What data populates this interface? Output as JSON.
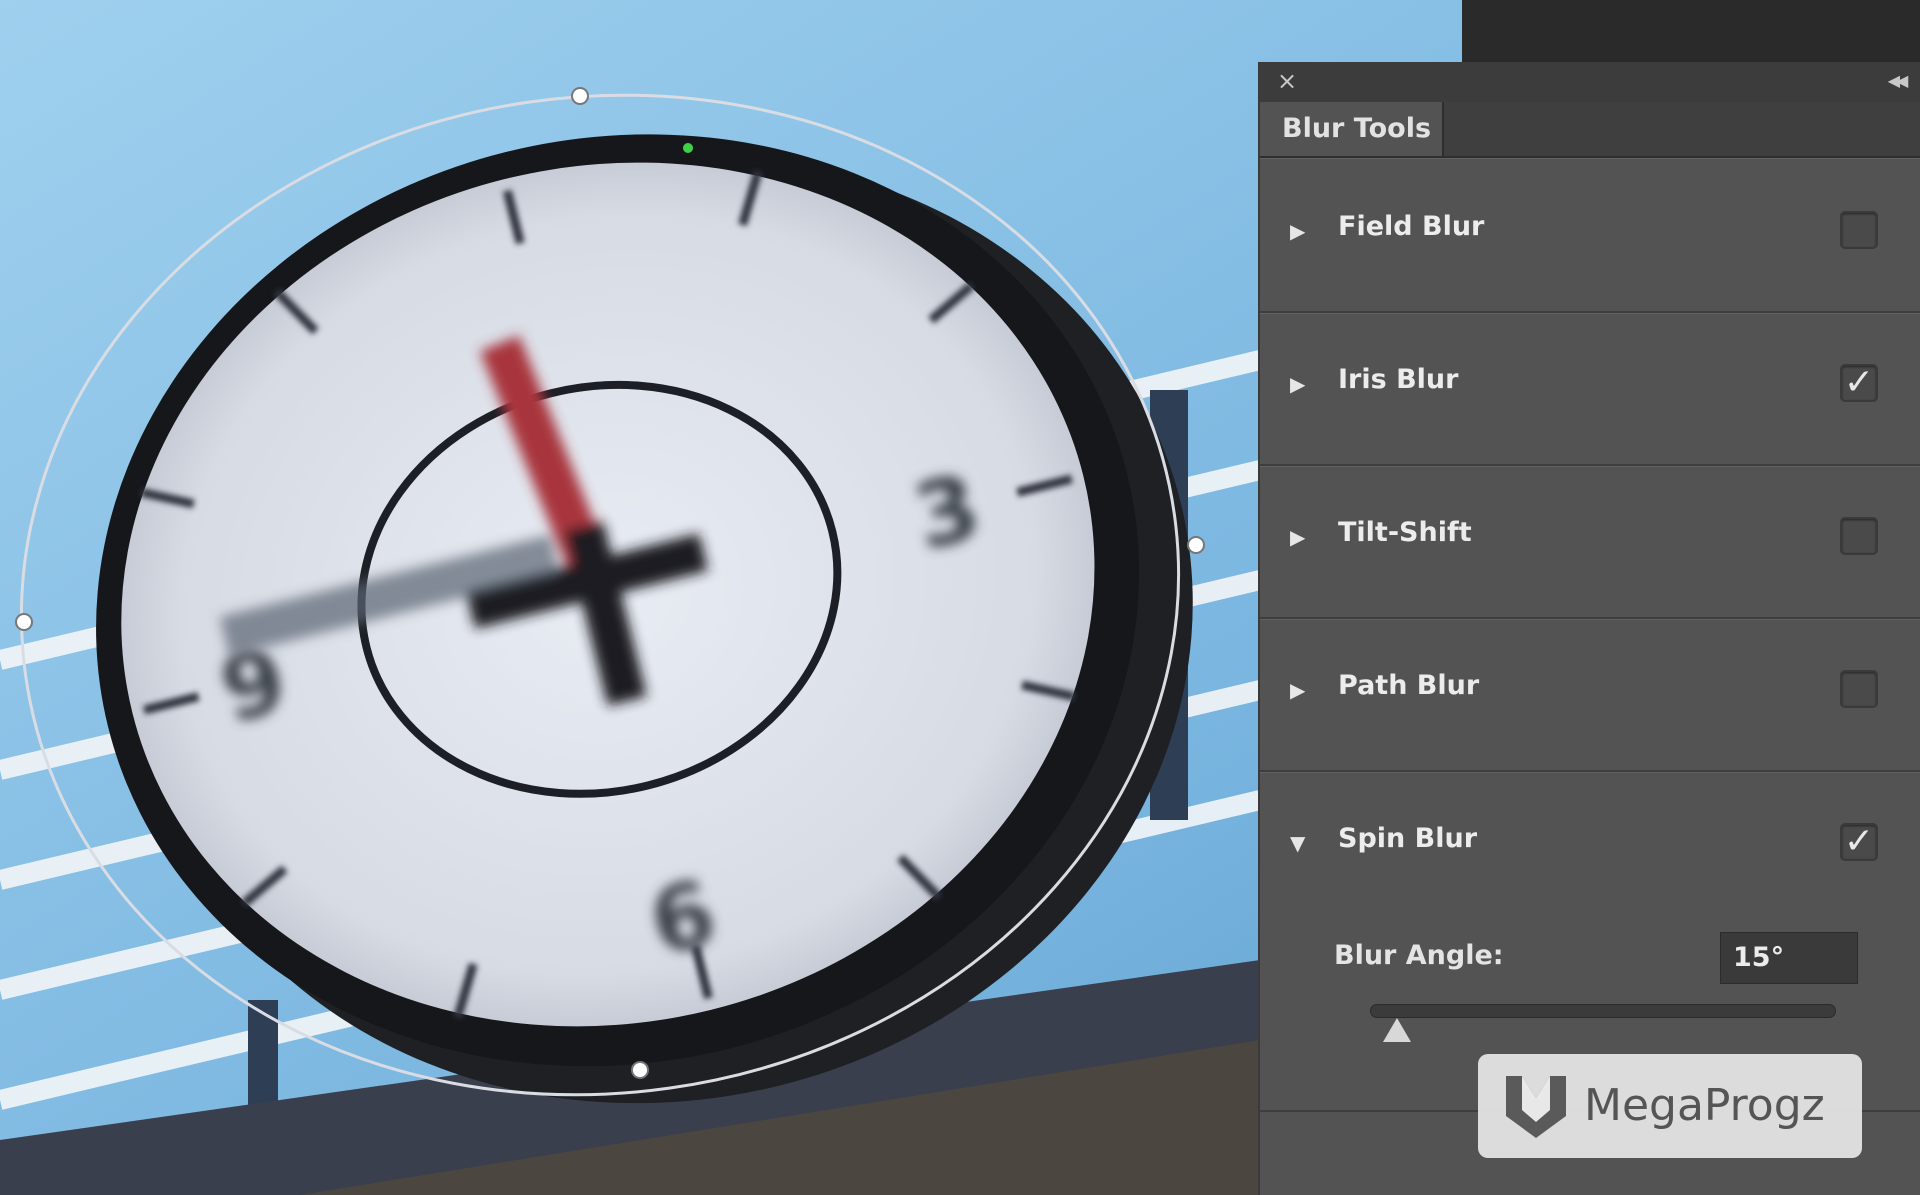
{
  "panel": {
    "close_icon": "close-icon",
    "collapse_icon": "double-chevron-left-icon",
    "tab_label": "Blur Tools",
    "sections": [
      {
        "label": "Field Blur",
        "expanded": false,
        "checked": false
      },
      {
        "label": "Iris Blur",
        "expanded": false,
        "checked": true
      },
      {
        "label": "Tilt-Shift",
        "expanded": false,
        "checked": false
      },
      {
        "label": "Path Blur",
        "expanded": false,
        "checked": false
      },
      {
        "label": "Spin Blur",
        "expanded": true,
        "checked": true
      }
    ],
    "spin_blur": {
      "angle_label": "Blur Angle:",
      "angle_value": "15°",
      "slider_fraction": 0.03
    }
  },
  "watermark": {
    "text": "MegaProgz"
  },
  "colors": {
    "sky": "#8ec6e8",
    "panel_bg": "#535353",
    "clock_red": "#a8343c"
  }
}
